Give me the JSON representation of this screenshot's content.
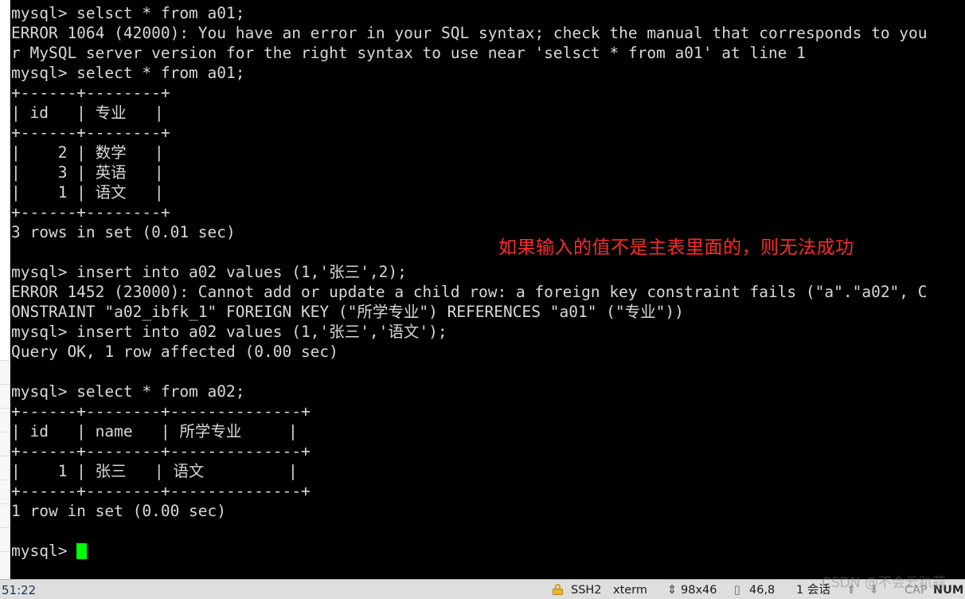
{
  "terminal": {
    "lines": [
      "mysql> selsct * from a01;",
      "ERROR 1064 (42000): You have an error in your SQL syntax; check the manual that corresponds to you",
      "r MySQL server version for the right syntax to use near 'selsct * from a01' at line 1",
      "mysql> select * from a01;",
      "+------+--------+",
      "| id   | 专业   |",
      "+------+--------+",
      "|    2 | 数学   |",
      "|    3 | 英语   |",
      "|    1 | 语文   |",
      "+------+--------+",
      "3 rows in set (0.01 sec)",
      "",
      "mysql> insert into a02 values (1,'张三',2);",
      "ERROR 1452 (23000): Cannot add or update a child row: a foreign key constraint fails (\"a\".\"a02\", C",
      "ONSTRAINT \"a02_ibfk_1\" FOREIGN KEY (\"所学专业\") REFERENCES \"a01\" (\"专业\"))",
      "mysql> insert into a02 values (1,'张三','语文');",
      "Query OK, 1 row affected (0.00 sec)",
      "",
      "mysql> select * from a02;",
      "+------+--------+--------------+",
      "| id   | name   | 所学专业     |",
      "+------+--------+--------------+",
      "|    1 | 张三   | 语文         |",
      "+------+--------+--------------+",
      "1 row in set (0.00 sec)",
      ""
    ],
    "prompt": "mysql> ",
    "cursor_color": "#00ff00"
  },
  "annotation": {
    "text": "如果输入的值不是主表里面的，则无法成功",
    "color": "#fb2b2b"
  },
  "statusbar": {
    "time": "51:22",
    "protocol": "SSH2",
    "terminal_type": "xterm",
    "size_icon": "resize-icon",
    "size": "98x46",
    "position_icon": "cursor-position-icon",
    "position": "46,8",
    "sessions": "1 会话",
    "arrows": "⬆ ⬇",
    "caps_lock": "CAP",
    "num_lock": "NUM"
  },
  "watermark": {
    "text": "CSDN @不会云趴蒜"
  }
}
